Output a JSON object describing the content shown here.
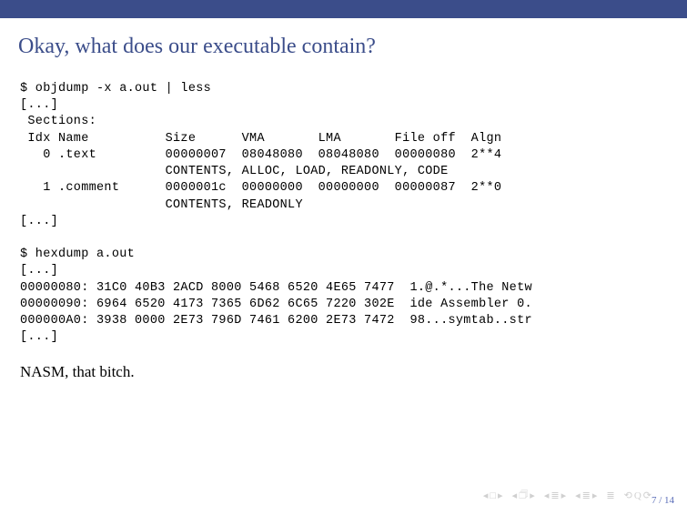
{
  "slide": {
    "title": "Okay, what does our executable contain?",
    "code": "$ objdump -x a.out | less\n[...]\n Sections:\n Idx Name          Size      VMA       LMA       File off  Algn\n   0 .text         00000007  08048080  08048080  00000080  2**4\n                   CONTENTS, ALLOC, LOAD, READONLY, CODE\n   1 .comment      0000001c  00000000  00000000  00000087  2**0\n                   CONTENTS, READONLY\n[...]\n\n$ hexdump a.out\n[...]\n00000080: 31C0 40B3 2ACD 8000 5468 6520 4E65 7477  1.@.*...The Netw\n00000090: 6964 6520 4173 7365 6D62 6C65 7220 302E  ide Assembler 0.\n000000A0: 3938 0000 2E73 796D 7461 6200 2E73 7472  98...symtab..str\n[...]",
    "comment": "NASM, that bitch.",
    "page": "7 / 14"
  }
}
